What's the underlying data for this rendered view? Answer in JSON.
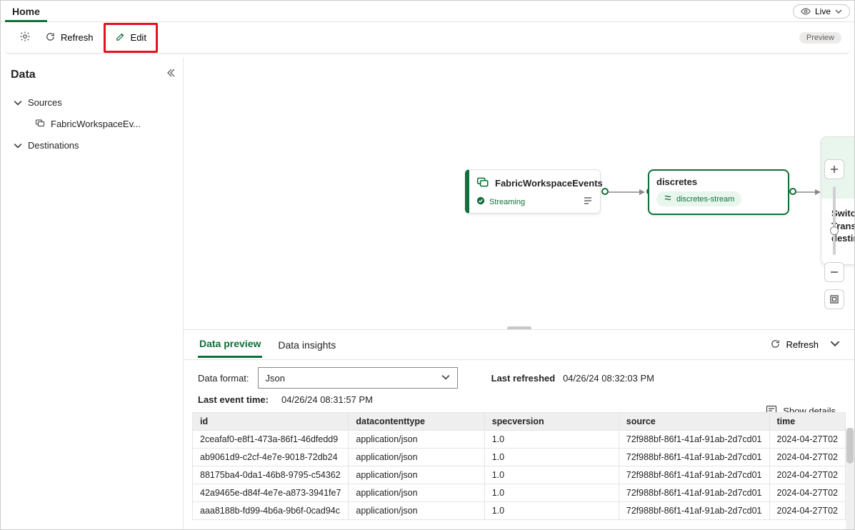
{
  "header": {
    "tab": "Home",
    "live_label": "Live"
  },
  "toolbar": {
    "refresh_label": "Refresh",
    "edit_label": "Edit",
    "preview_badge": "Preview"
  },
  "sidebar": {
    "title": "Data",
    "sections": {
      "sources_label": "Sources",
      "destinations_label": "Destinations"
    },
    "source_item": "FabricWorkspaceEv..."
  },
  "canvas": {
    "source_node": {
      "title": "FabricWorkspaceEvents",
      "status": "Streaming"
    },
    "stream_node": {
      "title": "discretes",
      "pill": "discretes-stream"
    },
    "dest_node": {
      "separator": "/",
      "hint": "Switch to edit mode to Transform event or add destination"
    }
  },
  "preview": {
    "tabs": {
      "data_preview": "Data preview",
      "data_insights": "Data insights"
    },
    "refresh": "Refresh",
    "data_format_label": "Data format:",
    "data_format_value": "Json",
    "last_refreshed_label": "Last refreshed",
    "last_refreshed_value": "04/26/24 08:32:03 PM",
    "last_event_label": "Last event time:",
    "last_event_value": "04/26/24 08:31:57 PM",
    "show_details": "Show details",
    "columns": [
      "id",
      "datacontenttype",
      "specversion",
      "source",
      "time"
    ],
    "rows": [
      {
        "id": "2ceafaf0-e8f1-473a-86f1-46dfedd9",
        "datacontenttype": "application/json",
        "specversion": "1.0",
        "source": "72f988bf-86f1-41af-91ab-2d7cd01",
        "time": "2024-04-27T02"
      },
      {
        "id": "ab9061d9-c2cf-4e7e-9018-72db24",
        "datacontenttype": "application/json",
        "specversion": "1.0",
        "source": "72f988bf-86f1-41af-91ab-2d7cd01",
        "time": "2024-04-27T02"
      },
      {
        "id": "88175ba4-0da1-46b8-9795-c54362",
        "datacontenttype": "application/json",
        "specversion": "1.0",
        "source": "72f988bf-86f1-41af-91ab-2d7cd01",
        "time": "2024-04-27T02"
      },
      {
        "id": "42a9465e-d84f-4e7e-a873-3941fe7",
        "datacontenttype": "application/json",
        "specversion": "1.0",
        "source": "72f988bf-86f1-41af-91ab-2d7cd01",
        "time": "2024-04-27T02"
      },
      {
        "id": "aaa8188b-fd99-4b6a-9b6f-0cad94c",
        "datacontenttype": "application/json",
        "specversion": "1.0",
        "source": "72f988bf-86f1-41af-91ab-2d7cd01",
        "time": "2024-04-27T02"
      }
    ]
  }
}
